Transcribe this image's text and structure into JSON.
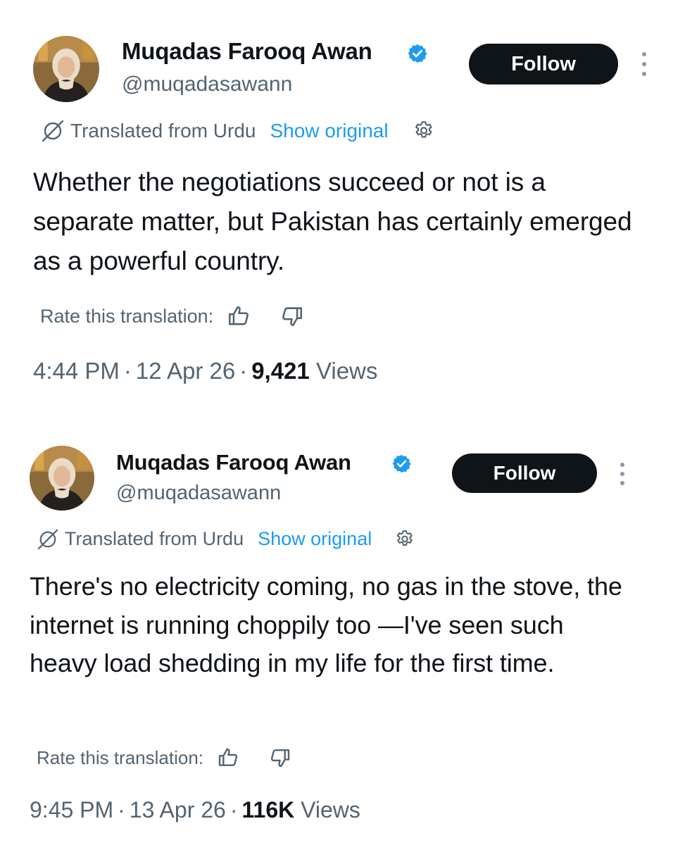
{
  "posts": [
    {
      "author": {
        "display_name": "Muqadas Farooq Awan",
        "handle": "@muqadasawann",
        "verified": true
      },
      "follow_label": "Follow",
      "translation": {
        "label": "Translated from Urdu",
        "show_original": "Show original"
      },
      "text": "Whether the negotiations succeed or not is a separate matter, but Pakistan has certainly emerged as a powerful country.",
      "rate_label": "Rate this translation:",
      "meta": {
        "time": "4:44 PM",
        "date": "12 Apr 26",
        "views_count": "9,421",
        "views_label": "Views"
      }
    },
    {
      "author": {
        "display_name": "Muqadas Farooq Awan",
        "handle": "@muqadasawann",
        "verified": true
      },
      "follow_label": "Follow",
      "translation": {
        "label": "Translated from Urdu",
        "show_original": "Show original"
      },
      "text": "There's no electricity coming, no gas in the stove, the internet is running choppily too —I've seen such heavy load shedding in my life for the first time.",
      "rate_label": "Rate this translation:",
      "meta": {
        "time": "9:45 PM",
        "date": "13 Apr 26",
        "views_count": "116K",
        "views_label": "Views"
      }
    }
  ],
  "colors": {
    "text_primary": "#0f1419",
    "text_secondary": "#536471",
    "link": "#1d9bf0",
    "verified_badge": "#1d9bf0",
    "follow_button_bg": "#0f1419",
    "follow_button_text": "#ffffff"
  },
  "icons": {
    "verified": "verified-badge-icon",
    "translate": "translate-icon",
    "settings": "gear-icon",
    "thumbs_up": "thumbs-up-icon",
    "thumbs_down": "thumbs-down-icon",
    "more": "more-vertical-icon"
  }
}
